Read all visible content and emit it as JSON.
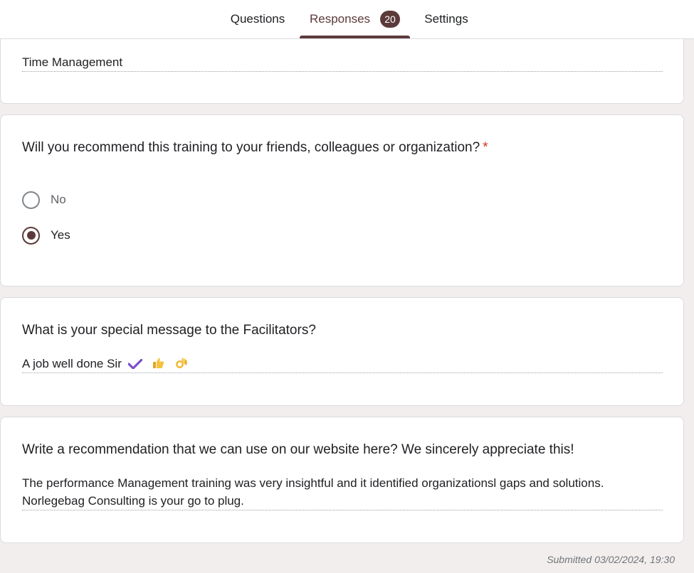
{
  "tabs": {
    "questions": "Questions",
    "responses": "Responses",
    "responses_count": "20",
    "settings": "Settings"
  },
  "card1": {
    "answer": "Time Management"
  },
  "card2": {
    "question": "Will you recommend this training to your friends, colleagues or organization?",
    "required_mark": "*",
    "options": [
      {
        "label": "No",
        "selected": false
      },
      {
        "label": "Yes",
        "selected": true
      }
    ]
  },
  "card3": {
    "question": "What is your special message to the Facilitators?",
    "answer": "A job well done Sir",
    "emojis": [
      "check-mark-icon",
      "thumbs-up-icon",
      "ok-hand-icon"
    ]
  },
  "card4": {
    "question": "Write a recommendation that we can use on our website here? We sincerely appreciate this!",
    "answer_line1": "The performance Management training was very insightful and it identified organizationsl gaps and solutions.",
    "answer_line2": "Norlegebag Consulting is your go to plug."
  },
  "footer": {
    "submitted": "Submitted 03/02/2024, 19:30"
  },
  "colors": {
    "accent": "#5d3a3a",
    "required": "#d93025",
    "background": "#f2eeed"
  }
}
